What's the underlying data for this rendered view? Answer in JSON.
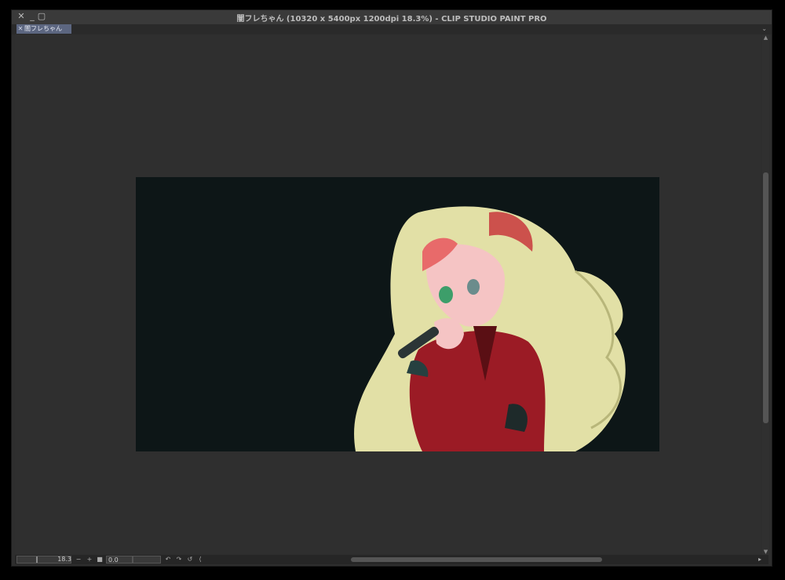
{
  "window": {
    "title": "闇フレちゃん (10320 x 5400px 1200dpi 18.3%)  - CLIP STUDIO PAINT PRO",
    "controls": {
      "close": "✕",
      "minimize": "_",
      "maximize": "▢"
    }
  },
  "tabs": [
    {
      "label": "闇フレちゃん",
      "close": "✕"
    }
  ],
  "tab_menu_icon": "⌄",
  "canvas": {
    "background": "#0d1617",
    "artwork_subject": "illustration of blonde girl in red jacket holding microphone"
  },
  "vscroll": {
    "up": "▲",
    "down": "▼"
  },
  "statusbar": {
    "zoom_value": "18.3",
    "zoom_out": "−",
    "zoom_in": "+",
    "fit": "■",
    "angle_value": "0.0",
    "rotate_left": "↶",
    "rotate_right": "↷",
    "reset_rotation": "↺",
    "flip": "⟨",
    "scroll_end": "▸"
  }
}
